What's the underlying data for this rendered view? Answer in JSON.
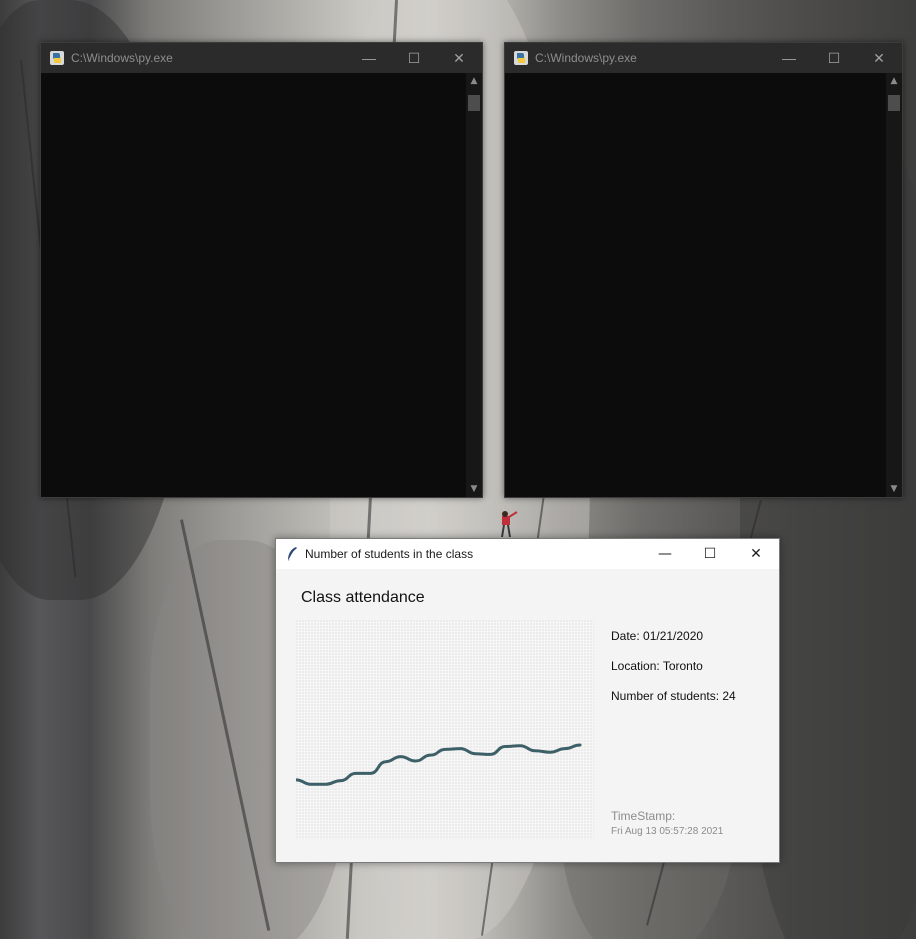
{
  "console_left": {
    "title": "C:\\Windows\\py.exe"
  },
  "console_right": {
    "title": "C:\\Windows\\py.exe"
  },
  "window_controls": {
    "minimize": "—",
    "maximize": "☐",
    "close": "✕"
  },
  "tk_window": {
    "title": "Number of students in the class",
    "heading": "Class attendance",
    "date": "Date: 01/21/2020",
    "location": "Location: Toronto",
    "students": "Number of students: 24",
    "timestamp_label": "TimeStamp:",
    "timestamp_value": "Fri Aug 13 05:57:28 2021"
  },
  "chart_data": {
    "type": "line",
    "title": "",
    "xlabel": "",
    "ylabel": "",
    "x": [
      0,
      1,
      2,
      3,
      4,
      5,
      6,
      7,
      8,
      9,
      10,
      11,
      12,
      13,
      14,
      15,
      16,
      17,
      18,
      19
    ],
    "series": [
      {
        "values": [
          8.0,
          7.4,
          7.4,
          7.9,
          8.9,
          8.9,
          10.5,
          11.2,
          10.6,
          11.4,
          12.2,
          12.3,
          11.6,
          11.5,
          12.6,
          12.7,
          12.0,
          11.8,
          12.3,
          12.8
        ]
      }
    ],
    "color": "#3c5f68",
    "ylim": [
      0,
      30
    ],
    "grid": false
  }
}
